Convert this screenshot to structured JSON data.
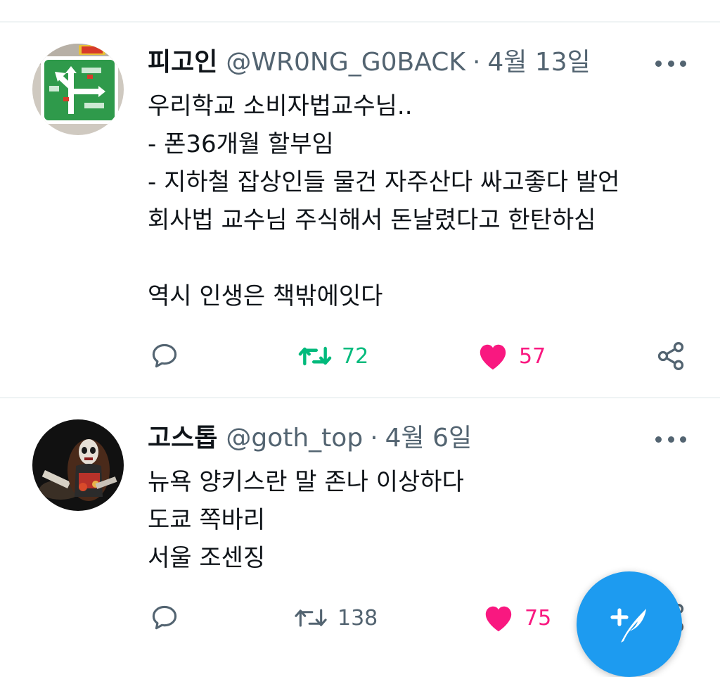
{
  "tweets": [
    {
      "display_name": "피고인",
      "handle": "@WR0NG_G0BACK",
      "separator": "·",
      "date": "4월 13일",
      "text": "우리학교 소비자법교수님..\n- 폰36개월 할부임\n- 지하철 잡상인들 물건 자주산다 싸고좋다 발언\n회사법 교수님 주식해서 돈날렸다고 한탄하심\n\n역시 인생은 책밖에잇다",
      "avatar": "green-road-sign",
      "reply_count": "",
      "retweet_count": "72",
      "like_count": "57",
      "retweeted": true,
      "liked": true
    },
    {
      "display_name": "고스톱",
      "handle": "@goth_top",
      "separator": "·",
      "date": "4월 6일",
      "text": "뉴욕 양키스란 말 존나 이상하다\n도쿄 쪽바리\n서울 조센징",
      "avatar": "costumed-person",
      "reply_count": "",
      "retweet_count": "138",
      "like_count": "75",
      "retweeted": false,
      "liked": true
    }
  ],
  "icons": {
    "reply": "reply-icon",
    "retweet": "retweet-icon",
    "like": "heart-icon",
    "share": "share-icon",
    "more": "more-options-icon",
    "compose": "compose-tweet-icon"
  },
  "colors": {
    "retweet_active": "#00ba7c",
    "like_active": "#f91880",
    "secondary_text": "#536471",
    "fab_blue": "#1d9bf0"
  }
}
